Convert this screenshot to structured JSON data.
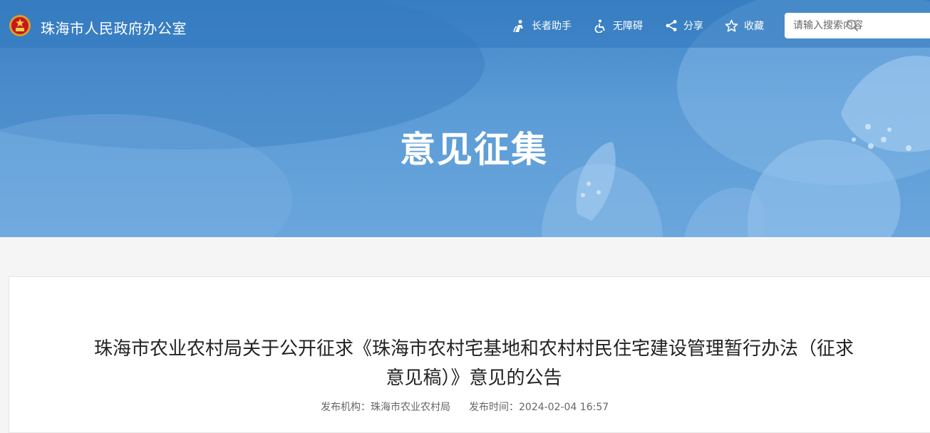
{
  "header": {
    "site_title": "珠海市人民政府办公室",
    "tools": {
      "elder_label": "长者助手",
      "accessibility_label": "无障碍",
      "share_label": "分享",
      "favorite_label": "收藏"
    },
    "search": {
      "placeholder": "请输入搜索内容",
      "value": ""
    }
  },
  "banner": {
    "title": "意见征集"
  },
  "article": {
    "title": "珠海市农业农村局关于公开征求《珠海市农村宅基地和农村村民住宅建设管理暂行办法（征求意见稿）》意见的公告",
    "publisher_label": "发布机构：",
    "publisher": "珠海市农业农村局",
    "time_label": "发布时间：",
    "time": "2024-02-04 16:57"
  },
  "icons": {
    "emblem": "national-emblem-icon",
    "elder": "elder-helper-icon",
    "accessibility": "wheelchair-icon",
    "share": "share-icon",
    "favorite": "star-icon",
    "search": "search-icon"
  },
  "colors": {
    "banner": "#4a8fd0",
    "title_text": "#ffffff",
    "body_text": "#222222"
  }
}
